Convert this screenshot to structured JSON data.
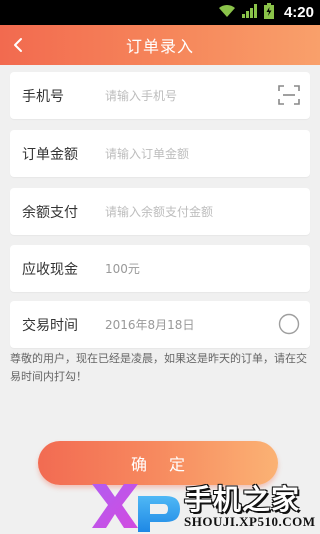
{
  "status_bar": {
    "time": "4:20"
  },
  "header": {
    "title": "订单录入"
  },
  "form": {
    "rows": [
      {
        "label": "手机号",
        "placeholder": "请输入手机号",
        "trailing_icon": "scan-icon"
      },
      {
        "label": "订单金额",
        "placeholder": "请输入订单金额"
      },
      {
        "label": "余额支付",
        "placeholder": "请输入余额支付金额"
      },
      {
        "label": "应收现金",
        "value": "100元"
      },
      {
        "label": "交易时间",
        "value": "2016年8月18日",
        "trailing_icon": "radio-circle-icon"
      }
    ]
  },
  "notice": "尊敬的用户，现在已经是凌晨，如果这是昨天的订单，请在交易时间内打勾！",
  "confirm_button": {
    "label": "确定"
  },
  "watermark": {
    "brand_cn": "手机之家",
    "url": "SHOUJI.XP510.COM",
    "logo_text": "XP"
  },
  "colors": {
    "header_start": "#f26a4f",
    "header_end": "#f9a06b",
    "button_start": "#f26b52",
    "button_end": "#fbb274"
  }
}
